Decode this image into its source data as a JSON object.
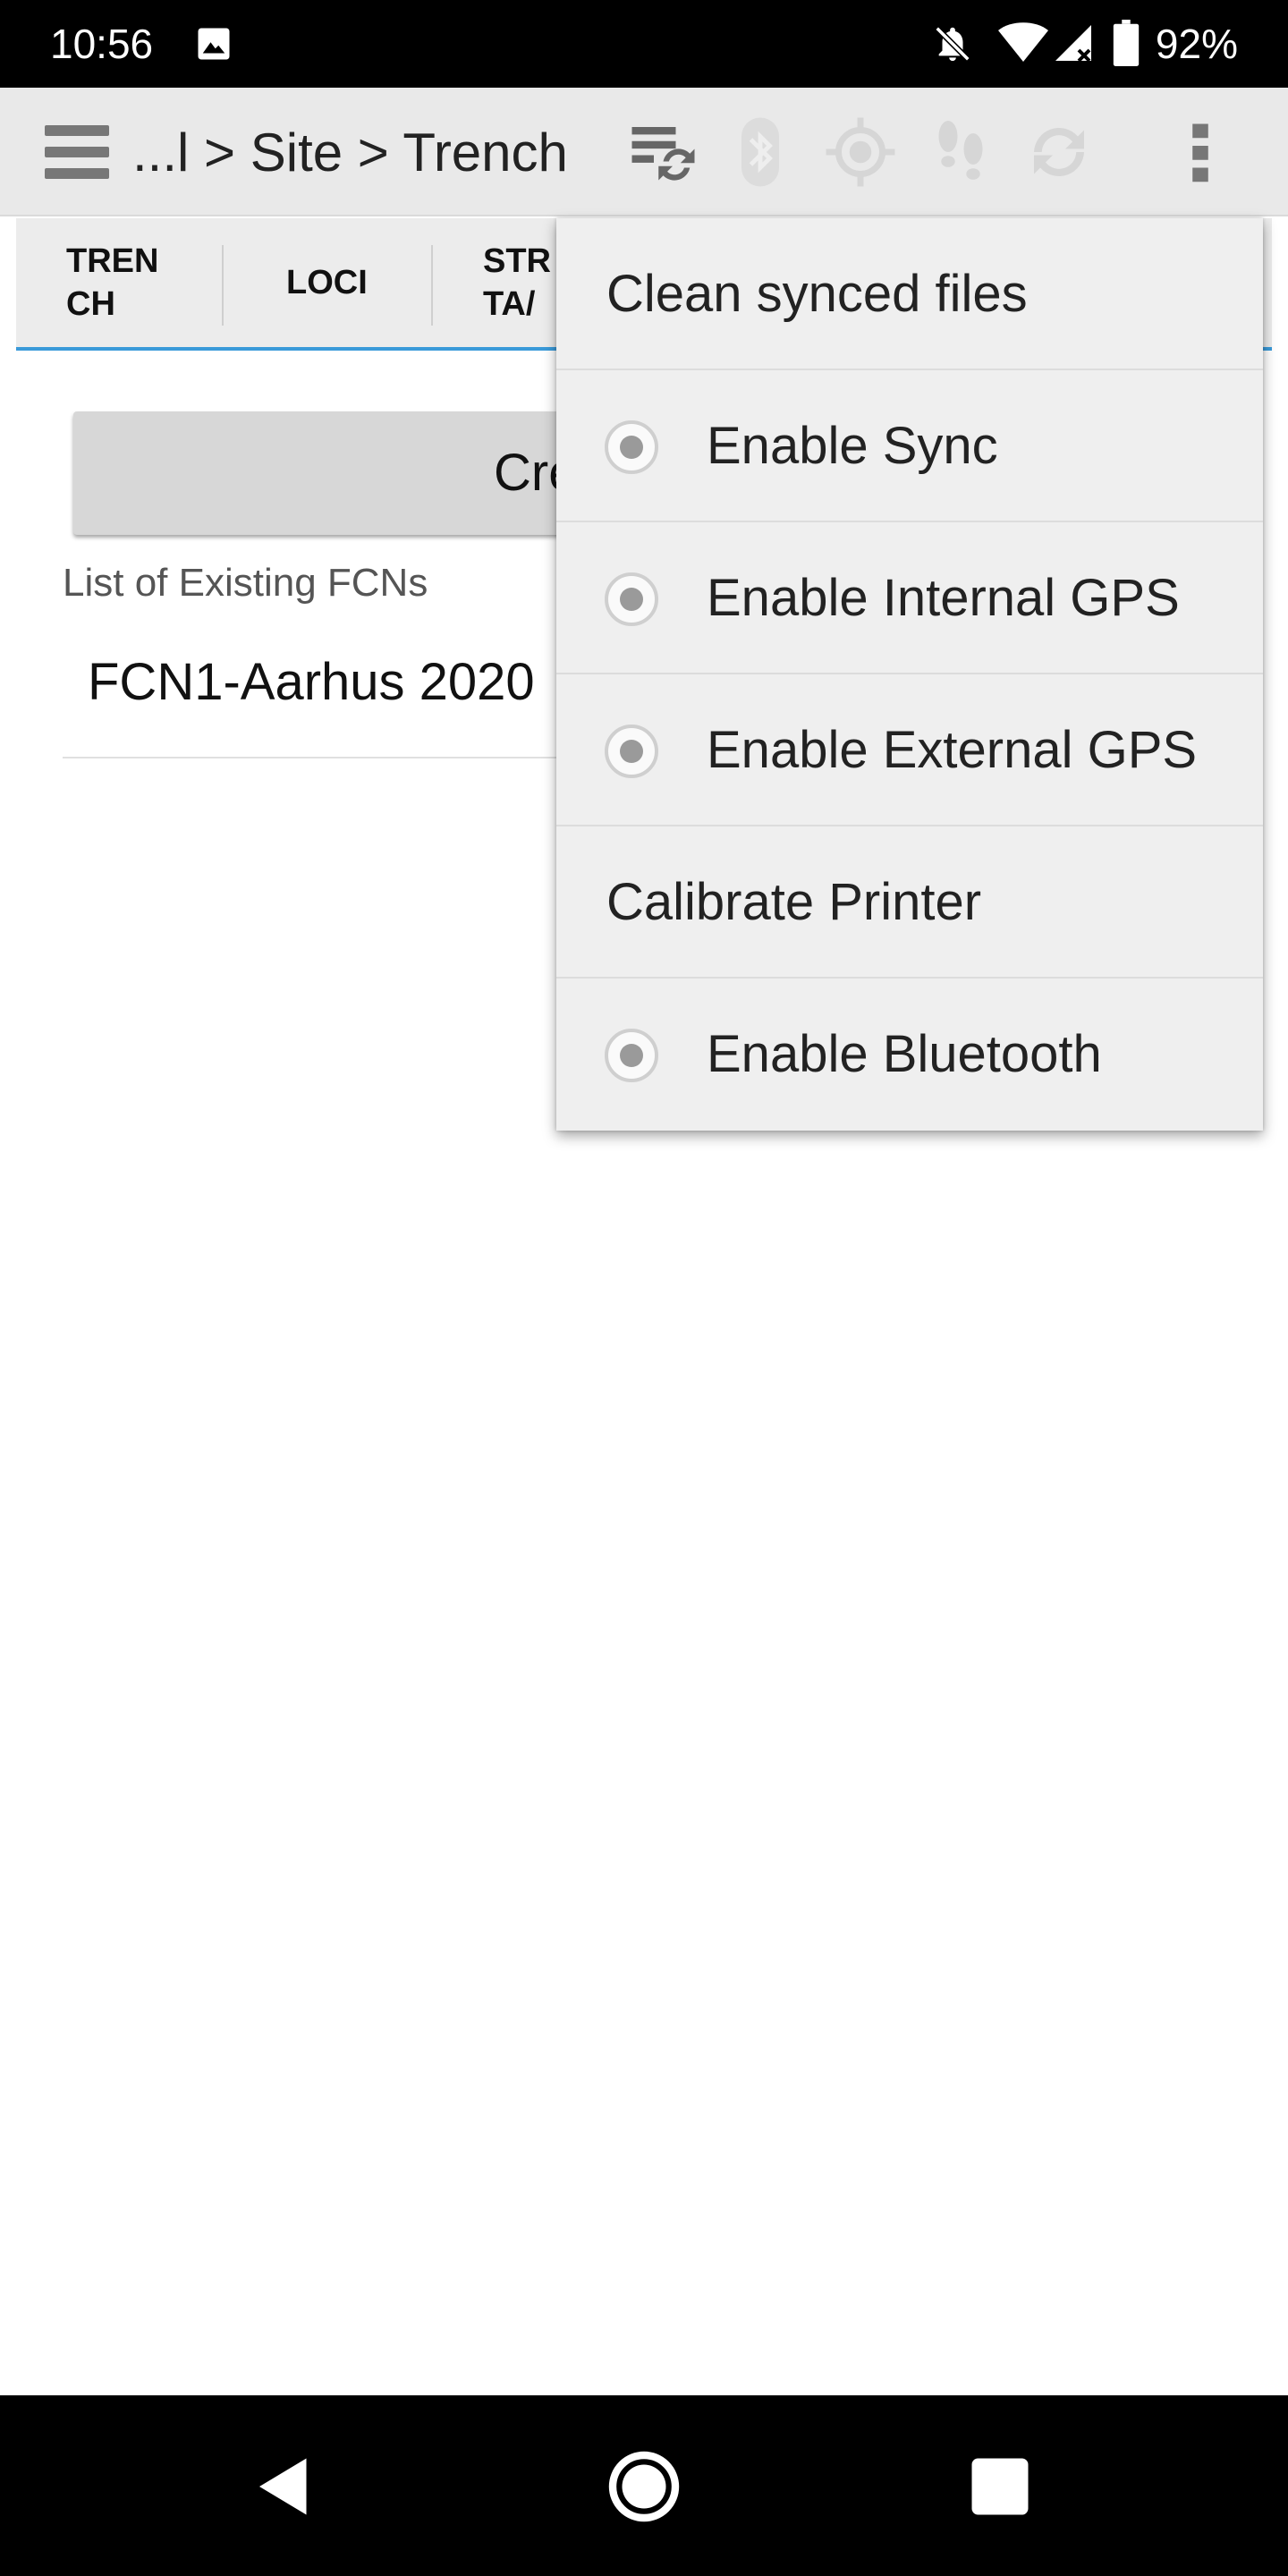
{
  "status_bar": {
    "time": "10:56",
    "battery": "92%",
    "icons": [
      "image-icon",
      "bell-off-icon",
      "wifi-icon",
      "signal-icon",
      "battery-icon"
    ]
  },
  "toolbar": {
    "breadcrumb": "...l > Site > Trench",
    "icons": [
      "menu-icon",
      "sync-settings-icon",
      "bluetooth-icon",
      "gps-icon",
      "footsteps-icon",
      "refresh-icon",
      "more-vert-icon"
    ]
  },
  "tabs": [
    {
      "label_line1": "TREN",
      "label_line2": "CH"
    },
    {
      "label_line1": "LOCI",
      "label_line2": ""
    },
    {
      "label_line1": "STR",
      "label_line2": "TA/"
    }
  ],
  "main": {
    "create_button": "Creat",
    "list_label": "List of Existing FCNs",
    "items": [
      "FCN1-Aarhus 2020"
    ]
  },
  "menu": {
    "items": [
      {
        "label": "Clean synced files",
        "has_radio": false
      },
      {
        "label": "Enable Sync",
        "has_radio": true
      },
      {
        "label": "Enable Internal GPS",
        "has_radio": true
      },
      {
        "label": "Enable External GPS",
        "has_radio": true
      },
      {
        "label": "Calibrate Printer",
        "has_radio": false
      },
      {
        "label": "Enable Bluetooth",
        "has_radio": true
      }
    ]
  },
  "colors": {
    "accent": "#3a9ad9",
    "toolbar_bg": "#e9e9e9",
    "menu_bg": "#efefef",
    "disabled_icon": "#d8d8d8"
  }
}
